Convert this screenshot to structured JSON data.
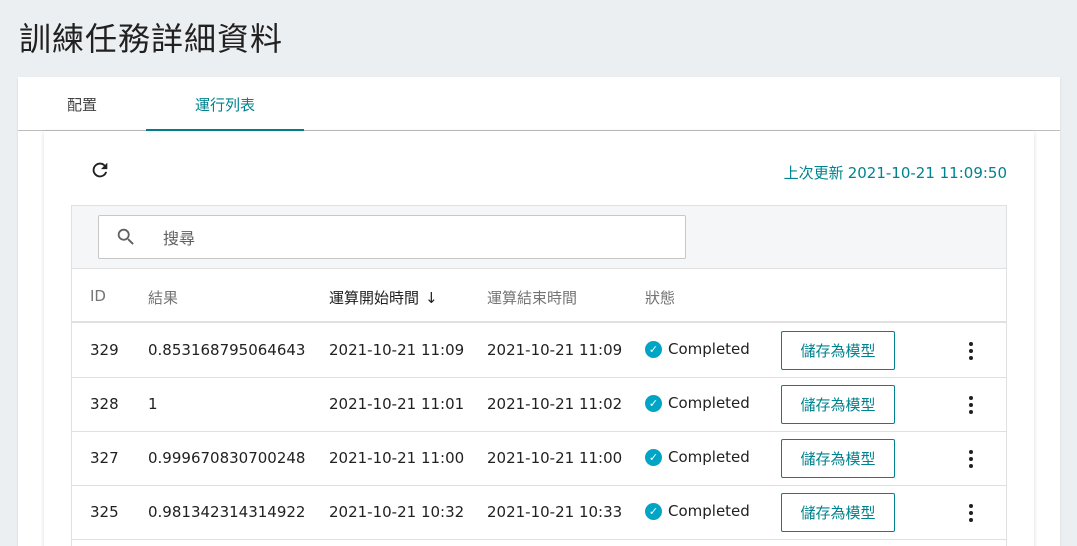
{
  "page": {
    "title": "訓練任務詳細資料"
  },
  "tabs": [
    {
      "label": "配置",
      "active": false
    },
    {
      "label": "運行列表",
      "active": true
    }
  ],
  "toolbar": {
    "last_updated_label": "上次更新",
    "last_updated_value": "2021-10-21 11:09:50"
  },
  "search": {
    "placeholder": "搜尋",
    "value": ""
  },
  "table": {
    "columns": [
      "ID",
      "結果",
      "運算開始時間",
      "運算結束時間",
      "狀態"
    ],
    "sorted_column": "運算開始時間",
    "sort_direction": "desc",
    "rows": [
      {
        "id": "329",
        "result": "0.853168795064643",
        "start": "2021-10-21 11:09",
        "end": "2021-10-21 11:09",
        "status": "Completed",
        "action": "儲存為模型"
      },
      {
        "id": "328",
        "result": "1",
        "start": "2021-10-21 11:01",
        "end": "2021-10-21 11:02",
        "status": "Completed",
        "action": "儲存為模型"
      },
      {
        "id": "327",
        "result": "0.999670830700248",
        "start": "2021-10-21 11:00",
        "end": "2021-10-21 11:00",
        "status": "Completed",
        "action": "儲存為模型"
      },
      {
        "id": "325",
        "result": "0.981342314314922",
        "start": "2021-10-21 10:32",
        "end": "2021-10-21 10:33",
        "status": "Completed",
        "action": "儲存為模型"
      }
    ]
  },
  "colors": {
    "accent": "#00838f",
    "status_completed": "#00a5c5",
    "background": "#eceff1"
  },
  "icons": {
    "refresh": "refresh-icon",
    "search": "search-icon",
    "sort": "arrow-down-icon",
    "status": "check-circle-icon",
    "more": "more-vertical-icon"
  }
}
